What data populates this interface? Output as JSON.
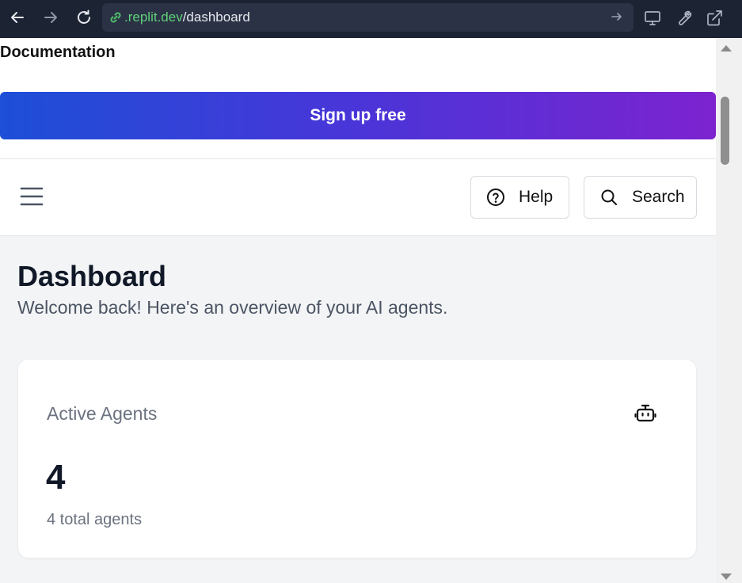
{
  "browser": {
    "url_domain": ".replit.dev",
    "url_path": "/dashboard"
  },
  "page": {
    "documentation_link": "Documentation",
    "signup_button": "Sign up free",
    "header": {
      "help_label": "Help",
      "search_label": "Search"
    },
    "dashboard": {
      "title": "Dashboard",
      "subtitle": "Welcome back! Here's an overview of your AI agents.",
      "card": {
        "label": "Active Agents",
        "value": "4",
        "note": "4 total agents",
        "icon": "robot-icon"
      }
    }
  },
  "colors": {
    "signup_gradient_start": "#1d4fd8",
    "signup_gradient_end": "#7c23cf",
    "browser_bar": "#1c2333",
    "url_domain": "#5fd07a",
    "dashboard_bg": "#f3f4f6"
  }
}
